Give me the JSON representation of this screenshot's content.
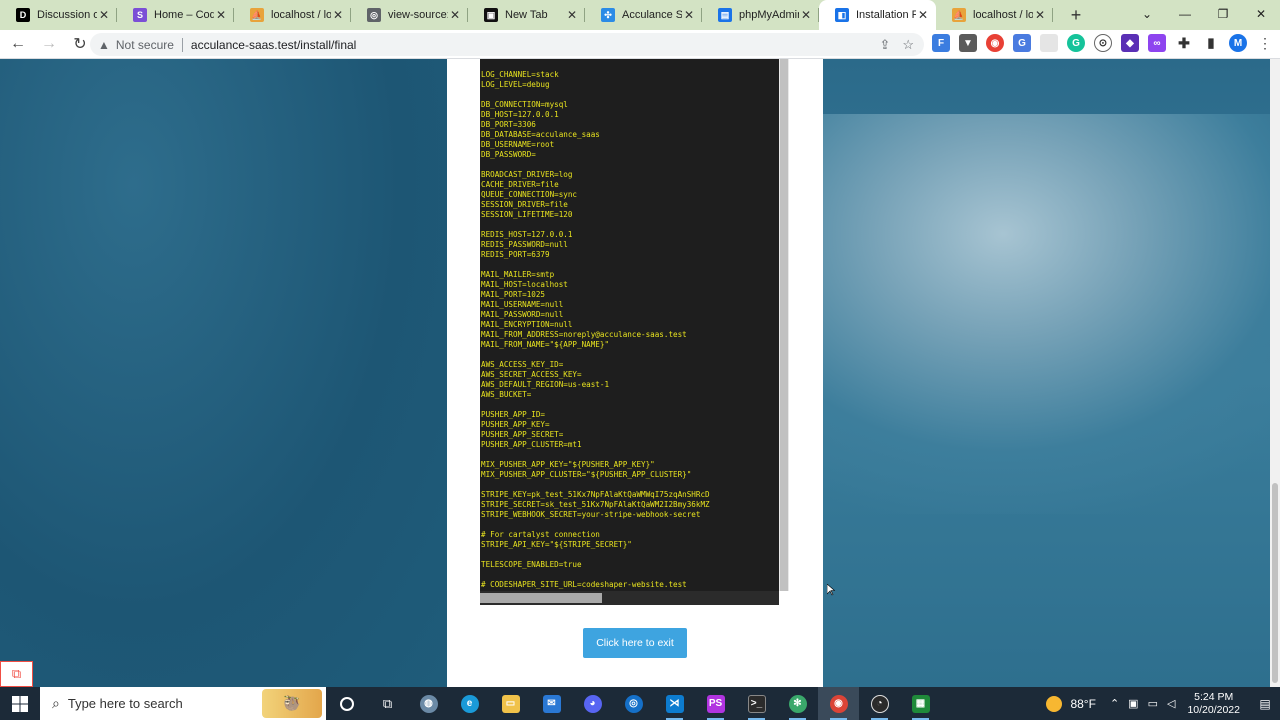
{
  "tabs": [
    {
      "title": "Discussion on",
      "favicon": "dev-community-icon",
      "color": "#000000",
      "glyph": "D"
    },
    {
      "title": "Home – Code",
      "favicon": "codeshaper-icon",
      "color": "#7b4fd6",
      "glyph": "S"
    },
    {
      "title": "localhost / loc",
      "favicon": "phpmyadmin-icon",
      "color": "#e8a33b",
      "glyph": "⛵"
    },
    {
      "title": "view-source:",
      "favicon": "globe-icon",
      "color": "#5f6368",
      "glyph": "◎"
    },
    {
      "title": "New Tab",
      "favicon": "vercel-icon",
      "color": "#111111",
      "glyph": "▣"
    },
    {
      "title": "Acculance Saa",
      "favicon": "acculance-icon",
      "color": "#2b8be6",
      "glyph": "✣"
    },
    {
      "title": "phpMyAdmin",
      "favicon": "doc-icon",
      "color": "#1a73e8",
      "glyph": "▤"
    },
    {
      "title": "Installation Fi",
      "favicon": "installer-icon",
      "color": "#1a73e8",
      "glyph": "◧",
      "active": true
    },
    {
      "title": "localhost / loc",
      "favicon": "phpmyadmin-icon",
      "color": "#e8a33b",
      "glyph": "⛵"
    }
  ],
  "browser": {
    "not_secure": "Not secure",
    "url": "acculance-saas.test/install/final"
  },
  "env_text": "LOG_CHANNEL=stack\nLOG_LEVEL=debug\n\nDB_CONNECTION=mysql\nDB_HOST=127.0.0.1\nDB_PORT=3306\nDB_DATABASE=acculance_saas\nDB_USERNAME=root\nDB_PASSWORD=\n\nBROADCAST_DRIVER=log\nCACHE_DRIVER=file\nQUEUE_CONNECTION=sync\nSESSION_DRIVER=file\nSESSION_LIFETIME=120\n\nREDIS_HOST=127.0.0.1\nREDIS_PASSWORD=null\nREDIS_PORT=6379\n\nMAIL_MAILER=smtp\nMAIL_HOST=localhost\nMAIL_PORT=1025\nMAIL_USERNAME=null\nMAIL_PASSWORD=null\nMAIL_ENCRYPTION=null\nMAIL_FROM_ADDRESS=noreply@acculance-saas.test\nMAIL_FROM_NAME=\"${APP_NAME}\"\n\nAWS_ACCESS_KEY_ID=\nAWS_SECRET_ACCESS_KEY=\nAWS_DEFAULT_REGION=us-east-1\nAWS_BUCKET=\n\nPUSHER_APP_ID=\nPUSHER_APP_KEY=\nPUSHER_APP_SECRET=\nPUSHER_APP_CLUSTER=mt1\n\nMIX_PUSHER_APP_KEY=\"${PUSHER_APP_KEY}\"\nMIX_PUSHER_APP_CLUSTER=\"${PUSHER_APP_CLUSTER}\"\n\nSTRIPE_KEY=pk_test_51Kx7NpFAlaKtQaWMWqI75zqAnSHRcD\nSTRIPE_SECRET=sk_test_51Kx7NpFAlaKtQaWM2I2Bmy36kMZ\nSTRIPE_WEBHOOK_SECRET=your-stripe-webhook-secret\n\n# For cartalyst connection\nSTRIPE_API_KEY=\"${STRIPE_SECRET}\"\n\nTELESCOPE_ENABLED=true\n\n# CODESHAPER_SITE_URL=codeshaper-website.test",
  "exit_button": "Click here to exit",
  "taskbar": {
    "search_placeholder": "Type here to search",
    "weather": "88°F",
    "time": "5:24 PM",
    "date": "10/20/2022"
  },
  "colors": {
    "env_text": "#e8e31f",
    "exit_button": "#3ea4e0",
    "tabbar": "#d3e3c4"
  }
}
